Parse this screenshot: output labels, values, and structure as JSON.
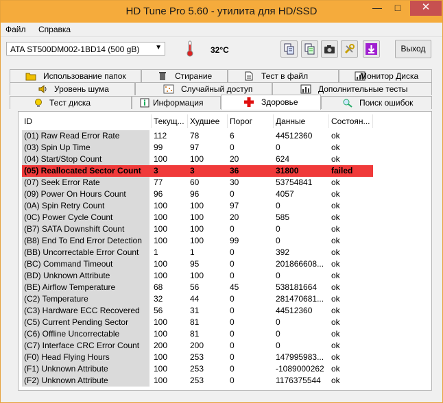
{
  "window": {
    "title": "HD Tune Pro 5.60 - утилита для HD/SSD"
  },
  "menu": {
    "file": "Файл",
    "help": "Справка"
  },
  "toolbar": {
    "drive": "ATA    ST500DM002-1BD14 (500 gB)",
    "temperature": "32°C",
    "exit_label": "Выход"
  },
  "tabs": {
    "row1": [
      "Использование папок",
      "Стирание",
      "Тест в файл",
      "Монитор Диска"
    ],
    "row2": [
      "Уровень шума",
      "Случайный доступ",
      "Дополнительные  тесты"
    ],
    "row3": [
      "Тест диска",
      "Информация",
      "Здоровье",
      "Поиск ошибок"
    ]
  },
  "table": {
    "headers": [
      "ID",
      "Текущ...",
      "Худшее",
      "Порог",
      "Данные",
      "Состоян..."
    ],
    "rows": [
      [
        "(01) Raw Read Error Rate",
        "112",
        "78",
        "6",
        "44512360",
        "ok"
      ],
      [
        "(03) Spin Up Time",
        "99",
        "97",
        "0",
        "0",
        "ok"
      ],
      [
        "(04) Start/Stop Count",
        "100",
        "100",
        "20",
        "624",
        "ok"
      ],
      [
        "(05) Reallocated Sector Count",
        "3",
        "3",
        "36",
        "31800",
        "failed"
      ],
      [
        "(07) Seek Error Rate",
        "77",
        "60",
        "30",
        "53754841",
        "ok"
      ],
      [
        "(09) Power On Hours Count",
        "96",
        "96",
        "0",
        "4057",
        "ok"
      ],
      [
        "(0A) Spin Retry Count",
        "100",
        "100",
        "97",
        "0",
        "ok"
      ],
      [
        "(0C) Power Cycle Count",
        "100",
        "100",
        "20",
        "585",
        "ok"
      ],
      [
        "(B7) SATA Downshift Count",
        "100",
        "100",
        "0",
        "0",
        "ok"
      ],
      [
        "(B8) End To End Error Detection",
        "100",
        "100",
        "99",
        "0",
        "ok"
      ],
      [
        "(BB) Uncorrectable Error Count",
        "1",
        "1",
        "0",
        "392",
        "ok"
      ],
      [
        "(BC) Command Timeout",
        "100",
        "95",
        "0",
        "201866608...",
        "ok"
      ],
      [
        "(BD) Unknown Attribute",
        "100",
        "100",
        "0",
        "0",
        "ok"
      ],
      [
        "(BE) Airflow Temperature",
        "68",
        "56",
        "45",
        "538181664",
        "ok"
      ],
      [
        "(C2) Temperature",
        "32",
        "44",
        "0",
        "281470681...",
        "ok"
      ],
      [
        "(C3) Hardware ECC Recovered",
        "56",
        "31",
        "0",
        "44512360",
        "ok"
      ],
      [
        "(C5) Current Pending Sector",
        "100",
        "81",
        "0",
        "0",
        "ok"
      ],
      [
        "(C6) Offline Uncorrectable",
        "100",
        "81",
        "0",
        "0",
        "ok"
      ],
      [
        "(C7) Interface CRC Error Count",
        "200",
        "200",
        "0",
        "0",
        "ok"
      ],
      [
        "(F0) Head Flying Hours",
        "100",
        "253",
        "0",
        "147995983...",
        "ok"
      ],
      [
        "(F1) Unknown Attribute",
        "100",
        "253",
        "0",
        "-1089000262",
        "ok"
      ],
      [
        "(F2) Unknown Attribute",
        "100",
        "253",
        "0",
        "1176375544",
        "ok"
      ]
    ]
  },
  "colors": {
    "titlebar": "#f5ab3c",
    "failed_row": "#f03a3a",
    "close": "#c75050"
  }
}
